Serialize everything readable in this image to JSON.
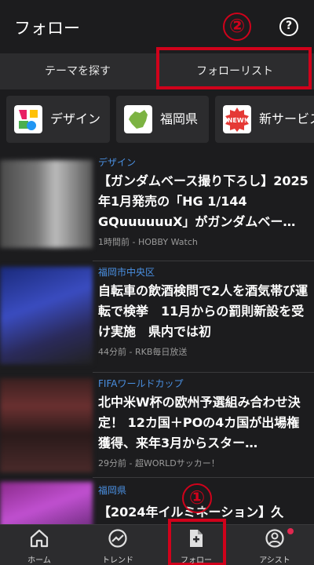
{
  "header": {
    "title": "フォロー",
    "marker": "②",
    "help_icon": "help-circle-icon"
  },
  "tabs": [
    {
      "label": "テーマを探す",
      "selected": false
    },
    {
      "label": "フォローリスト",
      "selected": true
    }
  ],
  "chips": [
    {
      "label": "デザイン",
      "icon": "design-logo-icon"
    },
    {
      "label": "福岡県",
      "icon": "fukuoka-map-icon"
    },
    {
      "label": "新サービス",
      "icon": "new-badge-icon",
      "badge_text": "NEW!"
    }
  ],
  "articles": [
    {
      "category": "デザイン",
      "headline": "【ガンダムベース撮り下ろし】2025年1月発売の「HG 1/144 GQuuuuuuX」がガンダムベー…",
      "meta": "1時間前 - HOBBY Watch"
    },
    {
      "category": "福岡市中央区",
      "headline": "自転車の飲酒検問で2人を酒気帯び運転で検挙　11月からの罰則新設を受け実施　県内では初",
      "meta": "44分前 - RKB毎日放送"
    },
    {
      "category": "FIFAワールドカップ",
      "headline": "北中米W杯の欧州予選組み合わせ決定！ 12カ国＋POの4カ国が出場権獲得、来年3月からスター…",
      "meta": "29分前 - 超WORLDサッカー！"
    },
    {
      "category": "福岡県",
      "headline": "【2024年イルミネーション】久",
      "meta": ""
    }
  ],
  "bottom_nav": [
    {
      "label": "ホーム",
      "icon": "home-icon"
    },
    {
      "label": "トレンド",
      "icon": "trend-chart-icon"
    },
    {
      "label": "フォロー",
      "icon": "follow-document-icon",
      "selected": true
    },
    {
      "label": "アシスト",
      "icon": "assist-user-icon",
      "notification": true
    }
  ],
  "annotation_marker_1": "①",
  "colors": {
    "accent_red": "#d0021b",
    "category_blue": "#4a90e2",
    "background": "#1c1c1e"
  }
}
